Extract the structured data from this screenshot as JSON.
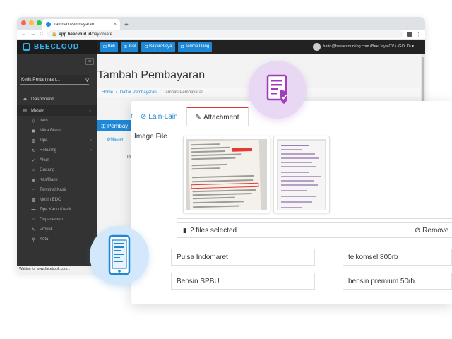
{
  "browser": {
    "tab_title": "Tambah Pembayaran",
    "tab_close": "×",
    "new_tab": "+",
    "url_host": "app.beecloud.id",
    "url_path": "/pay/create",
    "nav_back": "←",
    "nav_forward": "→",
    "nav_reload": "C"
  },
  "app": {
    "logo_text": "BEECLOUD",
    "nav": [
      {
        "label": "Beli",
        "icon": "cart"
      },
      {
        "label": "Jual",
        "icon": "cart"
      },
      {
        "label": "Bayar/Biaya",
        "icon": "money"
      },
      {
        "label": "Terima Uang",
        "icon": "money"
      }
    ],
    "user_text": "hafid@beeaccounting.com (Bee Jaya CV.) (GOLD) ▾"
  },
  "sidebar": {
    "search_placeholder": "Ketik Pertanyaan...",
    "items": [
      {
        "label": "Dashboard",
        "icon": "dashboard"
      },
      {
        "label": "Master",
        "icon": "master"
      }
    ],
    "sub_items": [
      {
        "label": "Item"
      },
      {
        "label": "Mitra Bisnis"
      },
      {
        "label": "Tipe"
      },
      {
        "label": "Rekuring"
      },
      {
        "label": "Akun"
      },
      {
        "label": "Gudang"
      },
      {
        "label": "Kas/Bank"
      },
      {
        "label": "Terminal Kasir"
      },
      {
        "label": "Mesin EDC"
      },
      {
        "label": "Tipe Kartu Kredit"
      },
      {
        "label": "Departemen"
      },
      {
        "label": "Proyek"
      },
      {
        "label": "Kota"
      }
    ],
    "status_text": "Waiting for www.facebook.com..."
  },
  "main": {
    "page_title": "Tambah Pembayaran",
    "breadcrumb": {
      "home": "Home",
      "sep": "/",
      "parent": "Daftar Pembayaran",
      "current": "Tambah Pembayaran"
    },
    "panel_title": "Pembay",
    "subtab_label": "Master",
    "frag_im": "Im"
  },
  "card": {
    "tab_frag": "r",
    "tabs": [
      {
        "label": "Lain-Lain",
        "icon": "check-circle"
      },
      {
        "label": "Attachment",
        "icon": "paperclip"
      }
    ],
    "image_label": "Image File",
    "files_selected": "2 files selected",
    "remove_label": "Remove",
    "fields": [
      "Pulsa Indomaret",
      "telkomsel 800rb",
      "Bensin SPBU",
      "bensin premium 50rb"
    ]
  },
  "colors": {
    "accent": "#1e88d8",
    "active_tab_border": "#e03535",
    "doc_badge": "#a43bbd",
    "phone_badge": "#1e88d8"
  }
}
